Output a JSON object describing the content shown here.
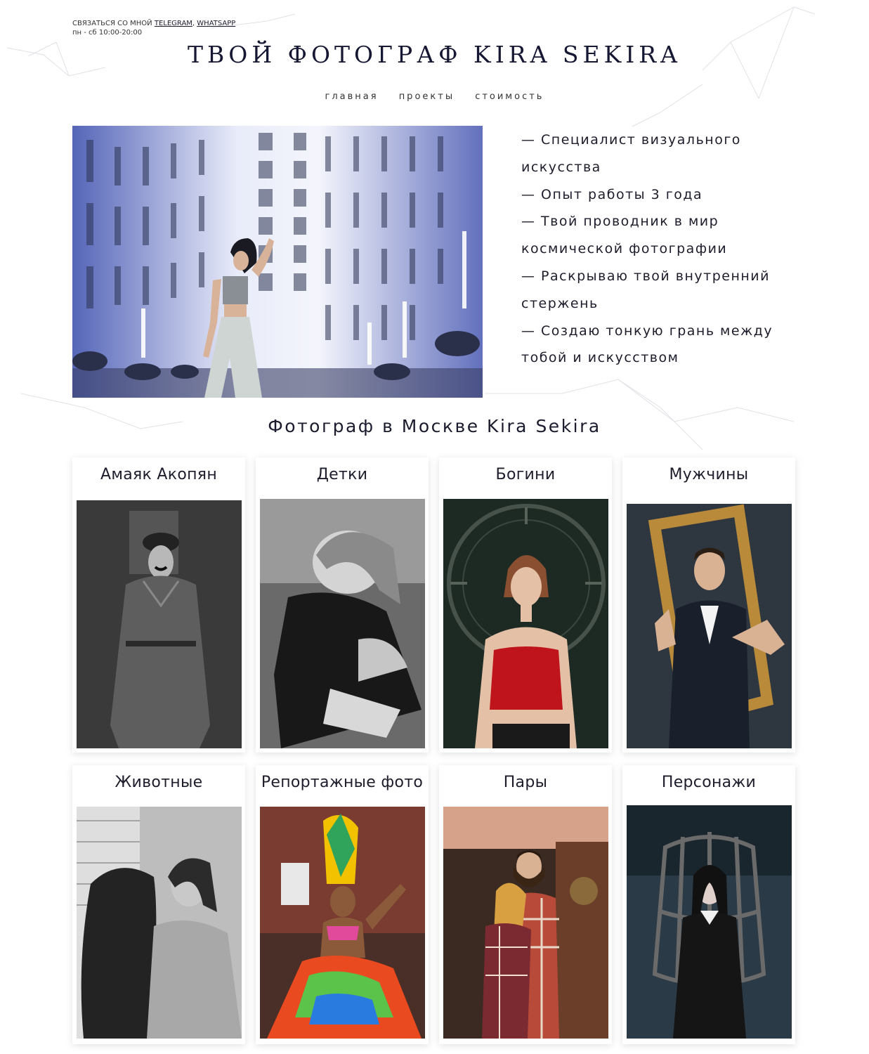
{
  "header": {
    "contact_prefix": "СВЯЗАТЬСЯ СО МНОЙ",
    "telegram_label": "TELEGRAM",
    "separator": ",",
    "whatsapp_label": "WHATSAPP",
    "hours": "пн - сб 10:00-20:00",
    "site_title": "ТВОЙ ФОТОГРАФ KIRA SEKIRA"
  },
  "nav": {
    "items": [
      {
        "label": "главная"
      },
      {
        "label": "проекты"
      },
      {
        "label": "стоимость"
      }
    ]
  },
  "about": {
    "lines": [
      "— Специалист визуального",
      "искусства",
      "— Опыт работы 3 года",
      "— Твой проводник в мир",
      "космической фотографии",
      "— Раскрываю твой внутренний",
      "стержень",
      "— Создаю тонкую грань между",
      "тобой и искусством"
    ]
  },
  "gallery": {
    "title": "Фотограф в Москве Kira Sekira",
    "cards": [
      {
        "title": "Амаяк Акопян"
      },
      {
        "title": "Детки"
      },
      {
        "title": "Богини"
      },
      {
        "title": "Мужчины"
      },
      {
        "title": "Животные"
      },
      {
        "title": "Репортажные фото"
      },
      {
        "title": "Пары"
      },
      {
        "title": "Персонажи"
      }
    ]
  },
  "colors": {
    "title": "#161833",
    "text": "#1d1d2c",
    "background": "#ffffff"
  }
}
